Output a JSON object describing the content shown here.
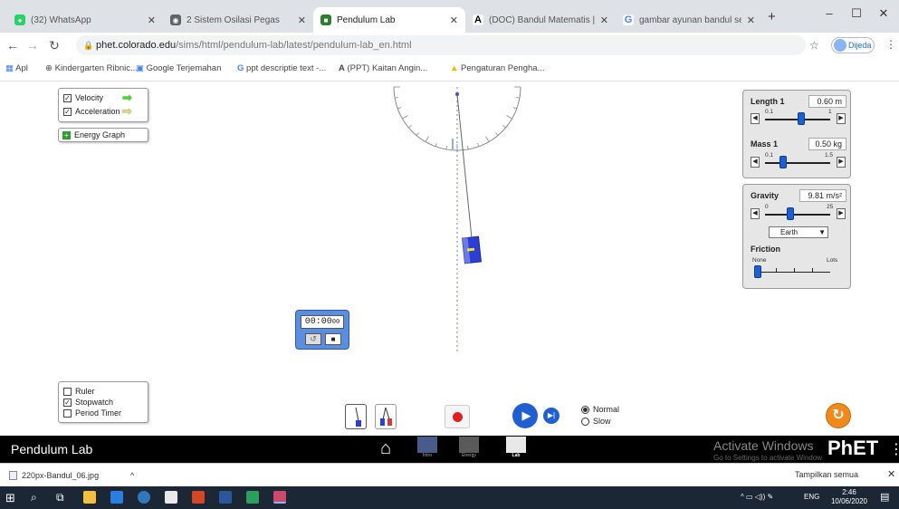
{
  "browser": {
    "tabs": [
      {
        "label": "(32) WhatsApp",
        "color": "#25d366",
        "glyph": "●"
      },
      {
        "label": "2 Sistem Osilasi Pegas",
        "color": "#5f6368",
        "glyph": "◉"
      },
      {
        "label": "Pendulum Lab",
        "color": "#2e7d32",
        "glyph": "■",
        "active": true
      },
      {
        "label": "(DOC) Bandul Matematis | Sci",
        "color": "#000000",
        "glyph": "A"
      },
      {
        "label": "gambar ayunan bandul seder",
        "color": "#4285f4",
        "glyph": "G"
      }
    ],
    "new_tab": "+",
    "url_host": "phet.colorado.edu",
    "url_path": "/sims/html/pendulum-lab/latest/pendulum-lab_en.html",
    "profile_label": "Dijeda",
    "bookmarks": [
      {
        "label": "Apl",
        "icon": "apps-icon"
      },
      {
        "label": "Kindergarten Ribnic...",
        "icon": "bookmark-icon"
      },
      {
        "label": "Google Terjemahan",
        "icon": "translate-icon"
      },
      {
        "label": "ppt descriptie text -...",
        "icon": "google-icon"
      },
      {
        "label": "(PPT) Kaitan Angin...",
        "icon": "academia-icon"
      },
      {
        "label": "Pengaturan Pengha...",
        "icon": "drive-icon"
      }
    ]
  },
  "sim": {
    "vectors": {
      "velocity_label": "Velocity",
      "acceleration_label": "Acceleration",
      "velocity_color": "#3fdc2a",
      "acceleration_color": "#f2e527"
    },
    "energy_graph_label": "Energy Graph",
    "length": {
      "label": "Length 1",
      "value": "0.60 m",
      "min": "0.1",
      "max": "1",
      "fraction": 0.55
    },
    "mass": {
      "label": "Mass 1",
      "value": "0.50 kg",
      "min": "0.1",
      "max": "1.5",
      "fraction": 0.28
    },
    "gravity": {
      "label": "Gravity",
      "value": "9.81 m/s²",
      "min": "0",
      "max": "25",
      "fraction": 0.39,
      "planet": "Earth"
    },
    "friction": {
      "label": "Friction",
      "min": "None",
      "max": "Lots",
      "fraction": 0.0
    },
    "stopwatch": {
      "time": "00:00",
      "hundredths": "00"
    },
    "tools": {
      "ruler": "Ruler",
      "stopwatch": "Stopwatch",
      "period_timer": "Period Timer"
    },
    "speed": {
      "normal": "Normal",
      "slow": "Slow"
    }
  },
  "phet": {
    "title": "Pendulum Lab",
    "screens": [
      "Intro",
      "Energy",
      "Lab"
    ],
    "activate_title": "Activate Windows",
    "activate_sub": "Go to Settings to activate Windows.",
    "logo": "PhET"
  },
  "download": {
    "file": "220px-Bandul_06.jpg",
    "show_all": "Tampilkan semua"
  },
  "taskbar": {
    "lang": "ENG",
    "time": "2:46",
    "date": "10/06/2020"
  }
}
